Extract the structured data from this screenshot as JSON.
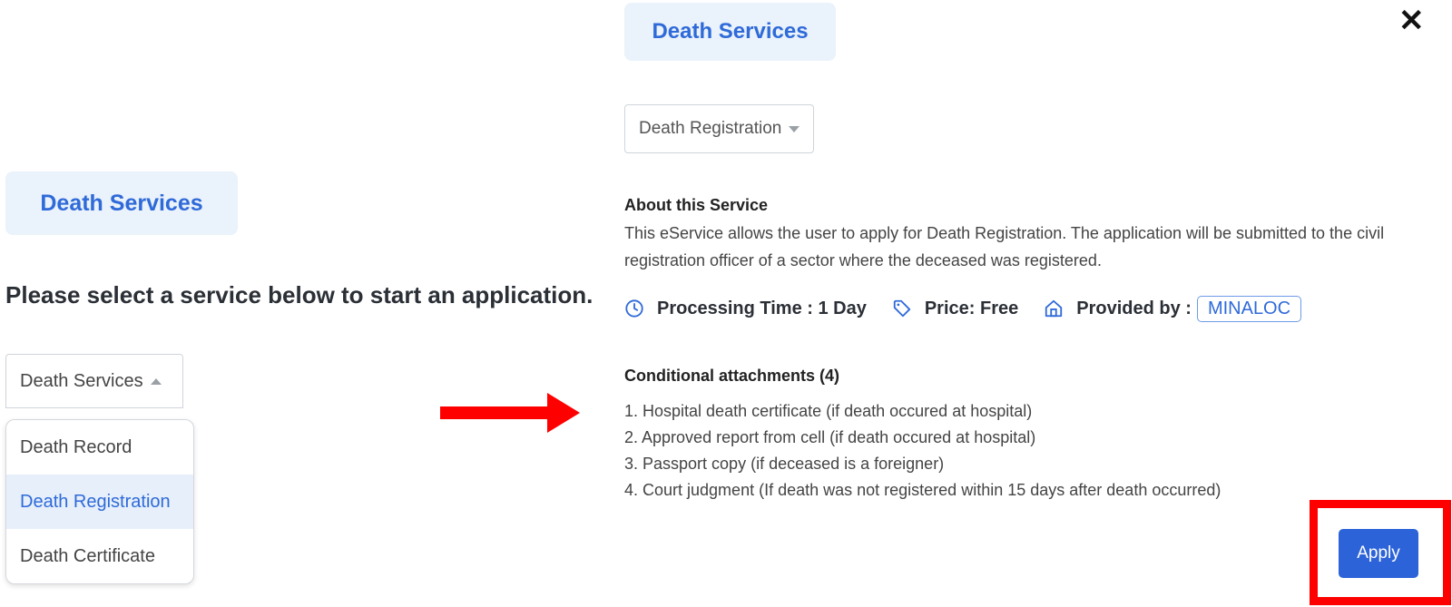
{
  "left": {
    "chip_title": "Death Services",
    "prompt": "Please select a service below to start an application.",
    "category_select": "Death Services",
    "options": [
      "Death Record",
      "Death Registration",
      "Death Certificate"
    ],
    "selected_option": "Death Registration"
  },
  "right": {
    "chip_title": "Death Services",
    "service_select": "Death Registration",
    "about_title": "About this Service",
    "about_text": "This eService allows the user to apply for Death Registration. The application will be submitted to the civil registration officer of a sector where the deceased was registered.",
    "processing_time": "Processing Time : 1 Day",
    "price": "Price: Free",
    "provided_by_label": "Provided by :",
    "provider": "MINALOC",
    "attachments_title": "Conditional attachments (4)",
    "attachments": [
      "1. Hospital death certificate (if death occured at hospital)",
      "2. Approved report from cell (if death occured at hospital)",
      "3. Passport copy (if deceased is a foreigner)",
      "4. Court judgment (If death was not registered within 15 days after death occurred)"
    ],
    "apply_label": "Apply"
  },
  "icons": {
    "close": "close-icon",
    "clock": "clock-icon",
    "tag": "price-tag-icon",
    "building": "building-icon",
    "arrow": "red-arrow-icon"
  },
  "colors": {
    "accent": "#2f6ad9",
    "chip_bg": "#eaf2fb",
    "highlight": "#ff0000",
    "apply_bg": "#2d63d9"
  }
}
